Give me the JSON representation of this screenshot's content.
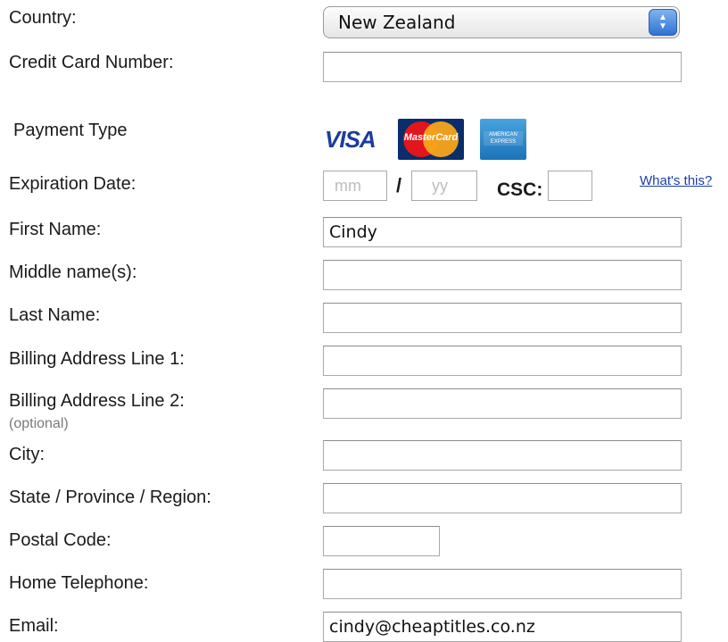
{
  "labels": {
    "country": "Country:",
    "credit_card": "Credit Card Number:",
    "payment_type": "Payment Type",
    "expiration": "Expiration Date:",
    "first_name": "First Name:",
    "middle_name": "Middle name(s):",
    "last_name": "Last Name:",
    "billing1": "Billing Address Line 1:",
    "billing2": "Billing Address Line 2:",
    "billing2_note": "(optional)",
    "city": "City:",
    "state": "State / Province / Region:",
    "postal": "Postal Code:",
    "phone": "Home Telephone:",
    "email": "Email:"
  },
  "country": {
    "selected": "New Zealand"
  },
  "cards": {
    "visa": "VISA",
    "mastercard": "MasterCard",
    "amex": "AMERICAN EXPRESS"
  },
  "expiration": {
    "mm_placeholder": "mm",
    "slash": "/",
    "yy_placeholder": "yy",
    "csc_label": "CSC:",
    "whats_this": "What's this?"
  },
  "values": {
    "credit_card": "",
    "first_name": "Cindy",
    "middle_name": "",
    "last_name": "",
    "billing1": "",
    "billing2": "",
    "city": "",
    "state": "",
    "postal": "",
    "phone": "",
    "email": "cindy@cheaptitles.co.nz"
  }
}
